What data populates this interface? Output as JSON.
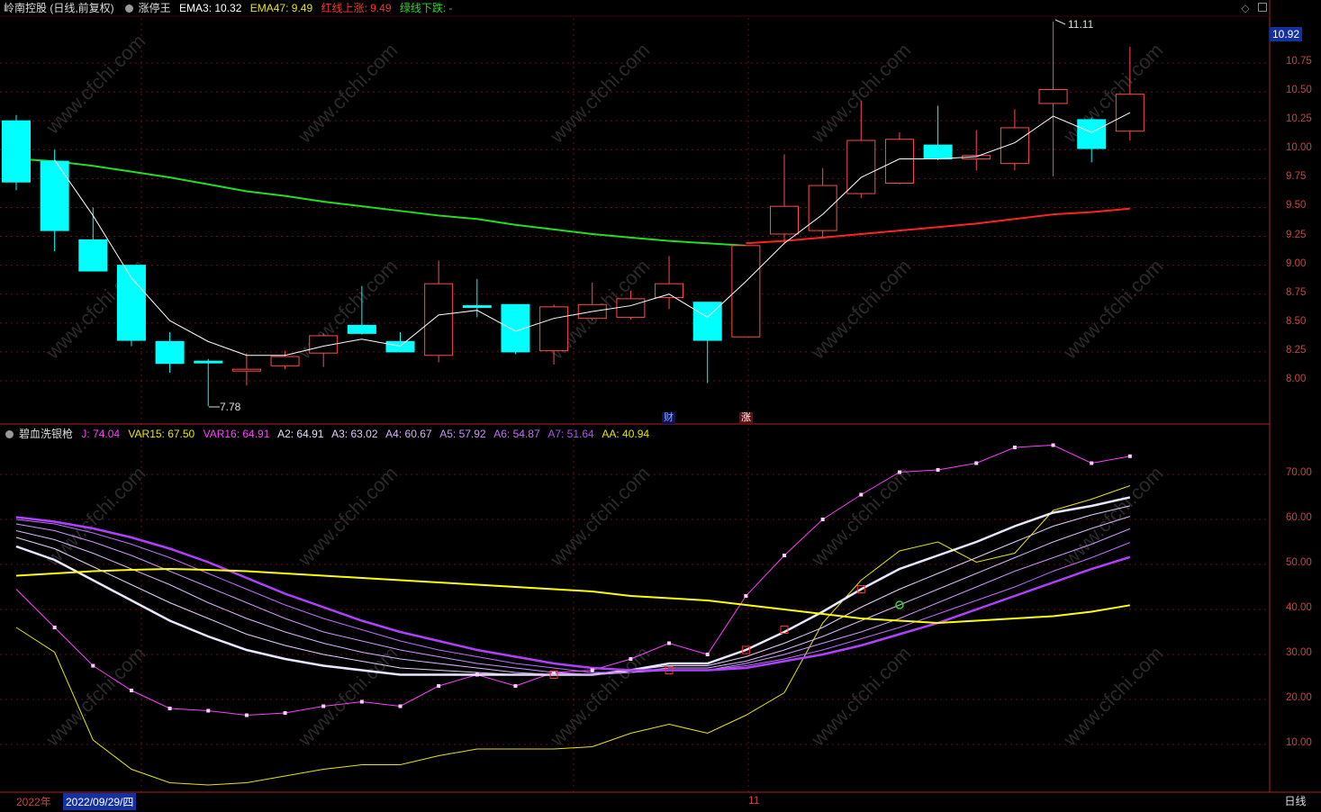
{
  "header1": {
    "title": "岭南控股 (日线,前复权)",
    "indicator": "涨停王",
    "ema3": "EMA3: 10.32",
    "ema47": "EMA47: 9.49",
    "red_up": "红线上涨: 9.49",
    "green_down": "绿线下跌: -"
  },
  "header2": {
    "indicator": "碧血洗银枪",
    "j": "J: 74.04",
    "var15": "VAR15: 67.50",
    "var16": "VAR16: 64.91",
    "a2": "A2: 64.91",
    "a3": "A3: 63.02",
    "a4": "A4: 60.67",
    "a5": "A5: 57.92",
    "a6": "A6: 54.87",
    "a7": "A7: 51.64",
    "aa": "AA: 40.94"
  },
  "price_axis": [
    "10.75",
    "10.50",
    "10.25",
    "10.00",
    "9.75",
    "9.50",
    "9.25",
    "9.00",
    "8.75",
    "8.50",
    "8.25",
    "8.00"
  ],
  "last_price": "10.92",
  "ind_axis": [
    "70.00",
    "60.00",
    "50.00",
    "40.00",
    "30.00",
    "20.00",
    "10.00"
  ],
  "annotations": {
    "high": "11.11",
    "low": "7.78",
    "cai": "财",
    "zhang": "涨"
  },
  "date_bar": {
    "year": "2022年",
    "cursor_date": "2022/09/29/四",
    "month": "11"
  },
  "day_button": "日线",
  "watermark": "www.cfchi.com",
  "colors": {
    "up": "#ff4a4a",
    "down": "#00ffff",
    "ema3": "#ffffff",
    "ema_green": "#22dd22",
    "ema_red": "#ff2222",
    "grid": "#6a1010"
  },
  "chart_data": [
    {
      "type": "candlestick",
      "title": "岭南控股 (日线,前复权)",
      "ylim": [
        7.75,
        11.15
      ],
      "candles": [
        {
          "o": 10.25,
          "h": 10.3,
          "l": 9.65,
          "c": 9.72
        },
        {
          "o": 9.9,
          "h": 10.0,
          "l": 9.12,
          "c": 9.3
        },
        {
          "o": 9.22,
          "h": 9.5,
          "l": 8.98,
          "c": 8.95
        },
        {
          "o": 9.0,
          "h": 9.0,
          "l": 8.3,
          "c": 8.35
        },
        {
          "o": 8.34,
          "h": 8.42,
          "l": 8.07,
          "c": 8.15
        },
        {
          "o": 8.17,
          "h": 8.19,
          "l": 7.78,
          "c": 8.16
        },
        {
          "o": 8.1,
          "h": 8.24,
          "l": 7.96,
          "c": 8.1
        },
        {
          "o": 8.13,
          "h": 8.26,
          "l": 8.1,
          "c": 8.21
        },
        {
          "o": 8.24,
          "h": 8.41,
          "l": 8.12,
          "c": 8.39
        },
        {
          "o": 8.48,
          "h": 8.82,
          "l": 8.4,
          "c": 8.41
        },
        {
          "o": 8.34,
          "h": 8.42,
          "l": 8.26,
          "c": 8.25
        },
        {
          "o": 8.22,
          "h": 9.04,
          "l": 8.16,
          "c": 8.84
        },
        {
          "o": 8.65,
          "h": 8.88,
          "l": 8.55,
          "c": 8.64
        },
        {
          "o": 8.66,
          "h": 8.66,
          "l": 8.23,
          "c": 8.25
        },
        {
          "o": 8.26,
          "h": 8.66,
          "l": 8.14,
          "c": 8.64
        },
        {
          "o": 8.54,
          "h": 8.85,
          "l": 8.52,
          "c": 8.66
        },
        {
          "o": 8.55,
          "h": 8.78,
          "l": 8.53,
          "c": 8.71
        },
        {
          "o": 8.72,
          "h": 9.08,
          "l": 8.62,
          "c": 8.84
        },
        {
          "o": 8.68,
          "h": 8.68,
          "l": 7.98,
          "c": 8.35
        },
        {
          "o": 8.38,
          "h": 9.17,
          "l": 8.38,
          "c": 9.17
        },
        {
          "o": 9.27,
          "h": 9.96,
          "l": 9.18,
          "c": 9.51
        },
        {
          "o": 9.3,
          "h": 9.84,
          "l": 9.24,
          "c": 9.69
        },
        {
          "o": 9.62,
          "h": 10.42,
          "l": 9.58,
          "c": 10.08
        },
        {
          "o": 9.71,
          "h": 10.15,
          "l": 9.7,
          "c": 10.09
        },
        {
          "o": 10.04,
          "h": 10.38,
          "l": 9.91,
          "c": 9.92
        },
        {
          "o": 9.92,
          "h": 10.17,
          "l": 9.82,
          "c": 9.95
        },
        {
          "o": 9.88,
          "h": 10.35,
          "l": 9.82,
          "c": 10.19
        },
        {
          "o": 10.4,
          "h": 11.11,
          "l": 9.77,
          "c": 10.52
        },
        {
          "o": 10.26,
          "h": 10.28,
          "l": 9.89,
          "c": 10.01
        },
        {
          "o": 10.16,
          "h": 10.89,
          "l": 10.08,
          "c": 10.48
        }
      ],
      "ema3": [
        null,
        9.91,
        9.43,
        8.89,
        8.52,
        8.34,
        8.22,
        8.22,
        8.3,
        8.36,
        8.3,
        8.57,
        8.61,
        8.43,
        8.54,
        8.6,
        8.65,
        8.75,
        8.55,
        8.86,
        9.19,
        9.44,
        9.76,
        9.92,
        9.92,
        9.94,
        10.06,
        10.29,
        10.15,
        10.32
      ],
      "ema_green": [
        9.92,
        9.9,
        9.86,
        9.81,
        9.76,
        9.7,
        9.64,
        9.6,
        9.55,
        9.51,
        9.47,
        9.43,
        9.4,
        9.35,
        9.31,
        9.27,
        9.24,
        9.21,
        9.19,
        9.17
      ],
      "ema_red": [
        9.19,
        9.21,
        9.24,
        9.27,
        9.3,
        9.33,
        9.36,
        9.4,
        9.44,
        9.46,
        9.49
      ]
    },
    {
      "type": "line",
      "title": "碧血洗银枪",
      "ylim": [
        0,
        80
      ],
      "series": [
        {
          "name": "J",
          "values": [
            44.5,
            36,
            27.5,
            22,
            18,
            17.5,
            16.5,
            17,
            18.5,
            19.5,
            18.5,
            23,
            25.5,
            23,
            26,
            26.5,
            29,
            32.5,
            30,
            43,
            52,
            60,
            65.5,
            70.5,
            71,
            72.5,
            76,
            76.5,
            72.5,
            74.04
          ]
        },
        {
          "name": "VAR15",
          "values": [
            36,
            30.5,
            11,
            4.5,
            1.5,
            1,
            1.5,
            3,
            4.5,
            5.5,
            5.5,
            7.5,
            9,
            9,
            9,
            9.5,
            12.5,
            14.5,
            12.5,
            16.5,
            21.5,
            37,
            46.5,
            53,
            55,
            50.5,
            52.5,
            62,
            64.5,
            67.5
          ]
        },
        {
          "name": "VAR16",
          "values": [
            54,
            51,
            46.5,
            42,
            37.5,
            34,
            31,
            29,
            27.5,
            26.5,
            25.5,
            25.5,
            25.5,
            25.5,
            25.5,
            25.5,
            26.5,
            28,
            28,
            31,
            35,
            39.5,
            44.5,
            49,
            52,
            55,
            58.5,
            61.5,
            63,
            64.91
          ]
        },
        {
          "name": "A2",
          "values": [
            56,
            53.5,
            49.5,
            45.5,
            41.5,
            38,
            34.5,
            32,
            30,
            28.5,
            27,
            26.5,
            26,
            25.5,
            25.5,
            25.5,
            26.5,
            27.5,
            27.5,
            29.5,
            32.5,
            36,
            40.5,
            44.5,
            48,
            51.5,
            55,
            58.5,
            61,
            63.02
          ]
        },
        {
          "name": "A3",
          "values": [
            57.5,
            55.5,
            52.5,
            49,
            45.5,
            41.5,
            38,
            35,
            32.5,
            30.5,
            29,
            28,
            27,
            26,
            25.5,
            25.5,
            26,
            27,
            27,
            28.5,
            31,
            34,
            37.5,
            41,
            44.5,
            48,
            51.5,
            55,
            58,
            60.67
          ]
        },
        {
          "name": "A4",
          "values": [
            59,
            57.5,
            55,
            52,
            48.5,
            45,
            41.5,
            38,
            35,
            33,
            31,
            29.5,
            28,
            27,
            26,
            25.5,
            26,
            26.5,
            26.5,
            28,
            30,
            32.5,
            35,
            38,
            41.5,
            45,
            48.5,
            51.5,
            54.5,
            57.92
          ]
        },
        {
          "name": "A5",
          "values": [
            60,
            59,
            57,
            54.5,
            51.5,
            48,
            44.5,
            41,
            38,
            35.5,
            33,
            31,
            29.5,
            28,
            27,
            26,
            26,
            26.5,
            26.5,
            27.5,
            29,
            31,
            33.5,
            36,
            39,
            42,
            45,
            48.5,
            51.5,
            54.87
          ]
        },
        {
          "name": "A6",
          "values": [
            60.5,
            59.5,
            58,
            56,
            53.5,
            50.5,
            47,
            43.5,
            40.5,
            37.5,
            35,
            33,
            31,
            29.5,
            28,
            27,
            26.5,
            26.5,
            26.5,
            27,
            28.5,
            30,
            32,
            34.5,
            37,
            40,
            43,
            46,
            49,
            51.64
          ]
        },
        {
          "name": "AA",
          "values": [
            47.5,
            48,
            48.5,
            48.8,
            49,
            48.8,
            48.5,
            48,
            47.5,
            47,
            46.5,
            46,
            45.5,
            45,
            44.5,
            44,
            43,
            42.5,
            42,
            41,
            40,
            39,
            38,
            37.5,
            37,
            37.5,
            38,
            38.5,
            39.5,
            40.94
          ]
        }
      ]
    }
  ]
}
